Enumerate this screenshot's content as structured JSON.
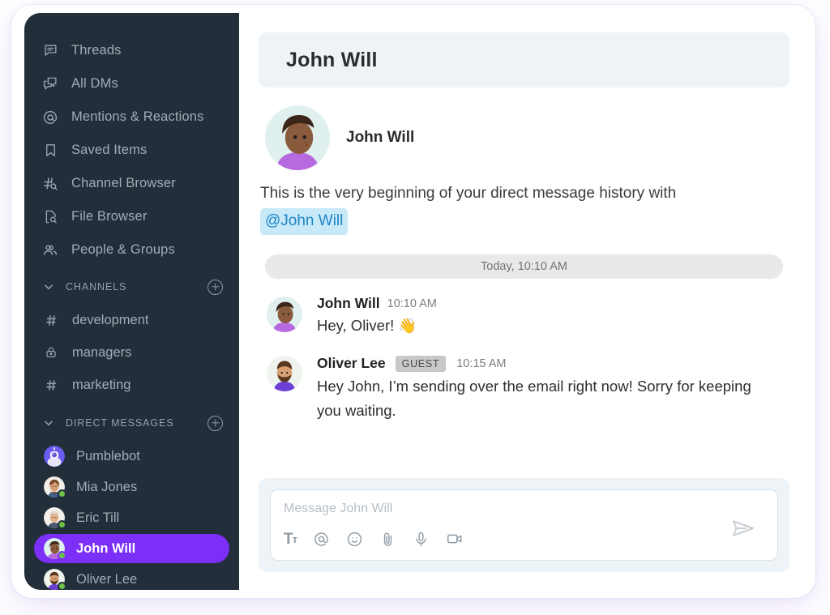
{
  "sidebar": {
    "nav": [
      {
        "label": "Threads",
        "icon": "threads-icon"
      },
      {
        "label": "All DMs",
        "icon": "all-dms-icon"
      },
      {
        "label": "Mentions & Reactions",
        "icon": "mentions-icon"
      },
      {
        "label": "Saved Items",
        "icon": "bookmark-icon"
      },
      {
        "label": "Channel Browser",
        "icon": "channel-browser-icon"
      },
      {
        "label": "File Browser",
        "icon": "file-browser-icon"
      },
      {
        "label": "People & Groups",
        "icon": "people-groups-icon"
      }
    ],
    "channels_section": {
      "title": "CHANNELS",
      "add_label": "+"
    },
    "channels": [
      {
        "name": "development",
        "icon": "hash-icon"
      },
      {
        "name": "managers",
        "icon": "lock-icon"
      },
      {
        "name": "marketing",
        "icon": "hash-icon"
      }
    ],
    "dms_section": {
      "title": "DIRECT MESSAGES",
      "add_label": "+"
    },
    "dms": [
      {
        "name": "Pumblebot",
        "active": false,
        "online": false,
        "avatar": "bot"
      },
      {
        "name": "Mia Jones",
        "active": false,
        "online": true,
        "avatar": "mia"
      },
      {
        "name": "Eric Till",
        "active": false,
        "online": true,
        "avatar": "eric"
      },
      {
        "name": "John Will",
        "active": true,
        "online": true,
        "avatar": "john"
      },
      {
        "name": "Oliver Lee",
        "active": false,
        "online": true,
        "avatar": "oliver"
      }
    ]
  },
  "header": {
    "title": "John Will"
  },
  "intro": {
    "name": "John Will",
    "text": "This is the very beginning of your direct message history with",
    "mention": "@John Will"
  },
  "divider": {
    "label": "Today, 10:10 AM"
  },
  "messages": [
    {
      "author": "John Will",
      "badge": "",
      "time": "10:10 AM",
      "text": "Hey, Oliver! 👋",
      "avatar": "john"
    },
    {
      "author": "Oliver Lee",
      "badge": "GUEST",
      "time": "10:15 AM",
      "text": "Hey John, I’m sending over the email right now! Sorry for keeping you waiting.",
      "avatar": "oliver"
    }
  ],
  "composer": {
    "placeholder": "Message John Will",
    "value": "",
    "tools": [
      {
        "name": "format-text-icon",
        "label": "Tт"
      },
      {
        "name": "mention-icon",
        "label": "@"
      },
      {
        "name": "emoji-icon",
        "label": "☺"
      },
      {
        "name": "attachment-icon",
        "label": "📎"
      },
      {
        "name": "microphone-icon",
        "label": "🎤"
      },
      {
        "name": "video-icon",
        "label": "🎥"
      }
    ],
    "send_label": "Send"
  },
  "colors": {
    "sidebar_bg": "#222e39",
    "active_dm": "#7b2ff7",
    "header_bg": "#eef3f7",
    "mention_bg": "#c8e9f8",
    "mention_fg": "#1d86c6",
    "online_dot": "#6ec24a",
    "guest_badge_bg": "#c8c8c8"
  }
}
